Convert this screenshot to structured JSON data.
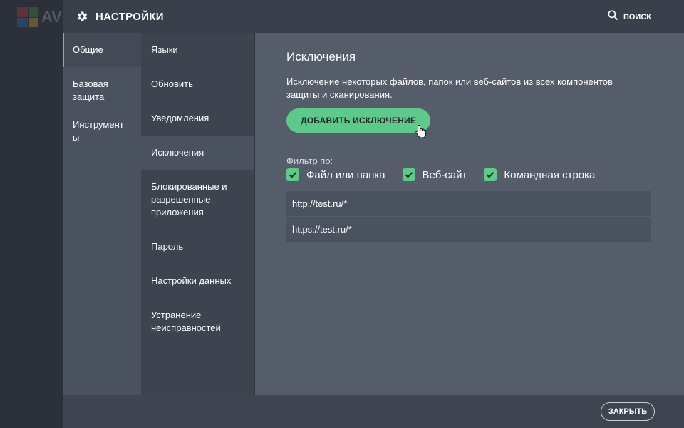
{
  "background_app": {
    "logo_text": "AVG"
  },
  "header": {
    "title": "НАСТРОЙКИ",
    "search_label": "ПОИСК"
  },
  "nav1": {
    "items": [
      {
        "label": "Общие"
      },
      {
        "label": "Базовая защита"
      },
      {
        "label": "Инструмент ы"
      }
    ],
    "active_index": 0
  },
  "nav2": {
    "items": [
      {
        "label": "Языки"
      },
      {
        "label": "Обновить"
      },
      {
        "label": "Уведомления"
      },
      {
        "label": "Исключения"
      },
      {
        "label": "Блокированные и разрешенные приложения"
      },
      {
        "label": "Пароль"
      },
      {
        "label": "Настройки данных"
      },
      {
        "label": "Устранение неисправностей"
      }
    ],
    "active_index": 3
  },
  "main": {
    "title": "Исключения",
    "description": "Исключение некоторых файлов, папок или веб-сайтов из всех компонентов защиты и сканирования.",
    "add_button": "ДОБАВИТЬ ИСКЛЮЧЕНИЕ",
    "filter_label": "Фильтр по:",
    "filters": [
      {
        "label": "Файл или папка",
        "checked": true
      },
      {
        "label": "Веб-сайт",
        "checked": true
      },
      {
        "label": "Командная строка",
        "checked": true
      }
    ],
    "exclusions": [
      {
        "value": "http://test.ru/*"
      },
      {
        "value": "https://test.ru/*"
      }
    ]
  },
  "footer": {
    "close_label": "ЗАКРЫТЬ"
  },
  "colors": {
    "accent": "#5ec98a",
    "header_bg": "#3a404b",
    "nav_bg": "#3d434f",
    "content_bg": "#565d6a",
    "row_bg": "#4b525f"
  },
  "icons": [
    "gear-icon",
    "search-icon",
    "check-icon",
    "hand-cursor-icon"
  ]
}
